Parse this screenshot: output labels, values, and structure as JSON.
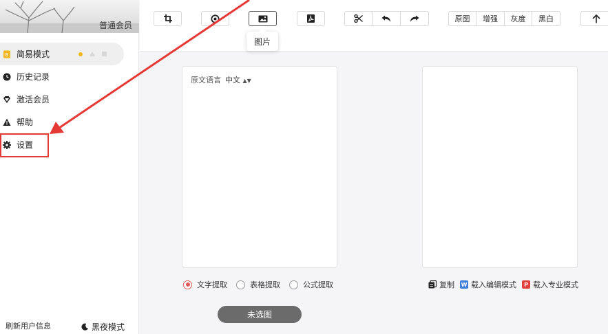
{
  "sidebar": {
    "member_label": "普通会员",
    "items": [
      {
        "label": "简易模式",
        "icon": "mode-icon"
      },
      {
        "label": "历史记录",
        "icon": "clock-icon"
      },
      {
        "label": "激活会员",
        "icon": "diamond-icon"
      },
      {
        "label": "帮助",
        "icon": "warning-icon"
      },
      {
        "label": "设置",
        "icon": "gear-icon"
      }
    ],
    "refresh_label": "刷新用户信息",
    "night_label": "黑夜模式"
  },
  "toolbar": {
    "buttons": [
      "crop-icon",
      "target-icon",
      "image-icon",
      "pdf-icon",
      "scissors-icon",
      "undo-icon",
      "redo-icon"
    ],
    "filters": [
      "原图",
      "增强",
      "灰度",
      "黑白"
    ],
    "upload_icon": "arrow-up-icon",
    "tooltip": "图片"
  },
  "left_panel": {
    "source_lang_label": "原文语言",
    "source_lang_value": "中文"
  },
  "options": {
    "modes": [
      "文字提取",
      "表格提取",
      "公式提取"
    ],
    "selected": "文字提取"
  },
  "right_actions": {
    "copy": "复制",
    "edit_mode": "载入编辑模式",
    "pro_mode": "载入专业模式",
    "edit_badge": "W",
    "pro_badge": "P"
  },
  "submit_label": "未选图",
  "colors": {
    "accent": "#e05a5a",
    "highlight": "#e53935",
    "word_blue": "#3d7bd8",
    "pdf_red": "#e0403b",
    "mode_icon": "#f2b81b"
  }
}
